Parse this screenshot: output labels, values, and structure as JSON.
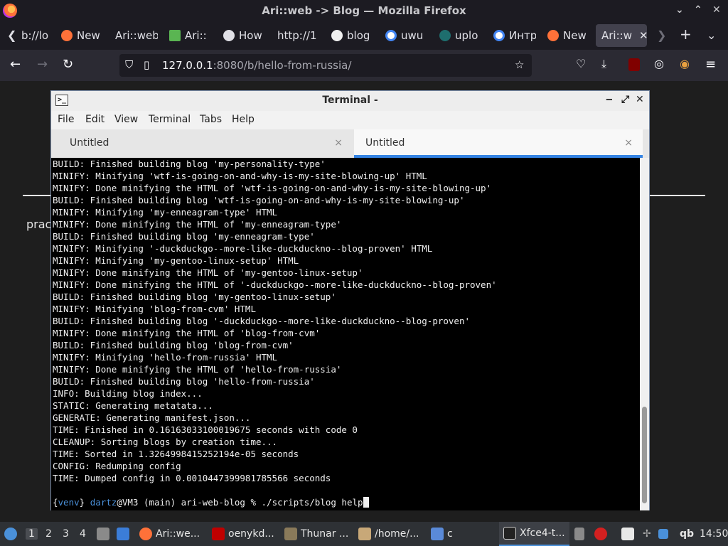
{
  "browser": {
    "title": "Ari::web -> Blog — Mozilla Firefox",
    "window_controls": [
      "⌄",
      "⌃",
      "✕"
    ],
    "tabs": [
      {
        "label": "b://lo",
        "icon": "none"
      },
      {
        "label": "New",
        "icon": "firefox-icon"
      },
      {
        "label": "Ari::web",
        "icon": "none"
      },
      {
        "label": "Ari::",
        "icon": "ari-icon"
      },
      {
        "label": "How",
        "icon": "how-icon"
      },
      {
        "label": "http://1",
        "icon": "none"
      },
      {
        "label": "blog",
        "icon": "github-icon"
      },
      {
        "label": "uwu",
        "icon": "google-icon"
      },
      {
        "label": "uplo",
        "icon": "upload-icon"
      },
      {
        "label": "Интр",
        "icon": "google-icon"
      },
      {
        "label": "New",
        "icon": "firefox-icon"
      },
      {
        "label": "Ari::w",
        "icon": "none",
        "active": true
      }
    ],
    "url_host": "127.0.0.1",
    "url_path": ":8080/b/hello-from-russia/",
    "page_fragment": "prac"
  },
  "terminal": {
    "title": "Terminal -",
    "menu": [
      "File",
      "Edit",
      "View",
      "Terminal",
      "Tabs",
      "Help"
    ],
    "tabs": [
      "Untitled",
      "Untitled"
    ],
    "output": [
      "BUILD: Finished building blog 'my-personality-type'",
      "MINIFY: Minifying 'wtf-is-going-on-and-why-is-my-site-blowing-up' HTML",
      "MINIFY: Done minifying the HTML of 'wtf-is-going-on-and-why-is-my-site-blowing-up'",
      "BUILD: Finished building blog 'wtf-is-going-on-and-why-is-my-site-blowing-up'",
      "MINIFY: Minifying 'my-enneagram-type' HTML",
      "MINIFY: Done minifying the HTML of 'my-enneagram-type'",
      "BUILD: Finished building blog 'my-enneagram-type'",
      "MINIFY: Minifying '-duckduckgo--more-like-duckduckno--blog-proven' HTML",
      "MINIFY: Minifying 'my-gentoo-linux-setup' HTML",
      "MINIFY: Done minifying the HTML of 'my-gentoo-linux-setup'",
      "MINIFY: Done minifying the HTML of '-duckduckgo--more-like-duckduckno--blog-proven'",
      "BUILD: Finished building blog 'my-gentoo-linux-setup'",
      "MINIFY: Minifying 'blog-from-cvm' HTML",
      "BUILD: Finished building blog '-duckduckgo--more-like-duckduckno--blog-proven'",
      "MINIFY: Done minifying the HTML of 'blog-from-cvm'",
      "BUILD: Finished building blog 'blog-from-cvm'",
      "MINIFY: Minifying 'hello-from-russia' HTML",
      "MINIFY: Done minifying the HTML of 'hello-from-russia'",
      "BUILD: Finished building blog 'hello-from-russia'",
      "INFO: Building blog index...",
      "STATIC: Generating metatata...",
      "GENERATE: Generating manifest.json...",
      "TIME: Finished in 0.16163033100019675 seconds with code 0",
      "CLEANUP: Sorting blogs by creation time...",
      "TIME: Sorted in 1.3264998415252194e-05 seconds",
      "CONFIG: Redumping config",
      "TIME: Dumped config in 0.0010447399981785566 seconds",
      ""
    ],
    "prompt": {
      "open": "{",
      "venv": "venv",
      "close": "}",
      "user": "dartz",
      "rest": "@VM3 (main) ari-web-blog % ./scripts/blog help"
    }
  },
  "taskbar": {
    "workspaces": [
      "1",
      "2",
      "3",
      "4"
    ],
    "windows": [
      {
        "label": "Ari::we...",
        "icon": "firefox-icon"
      },
      {
        "label": "oenykd...",
        "icon": "filezilla-icon"
      },
      {
        "label": "Thunar ...",
        "icon": "thunar-icon"
      },
      {
        "label": "/home/...",
        "icon": "archive-icon"
      },
      {
        "label": "c",
        "icon": "folder-icon"
      },
      {
        "label": "Xfce4-t...",
        "icon": "terminal-icon"
      }
    ],
    "tray_text": "qb",
    "clock": "14:50"
  }
}
